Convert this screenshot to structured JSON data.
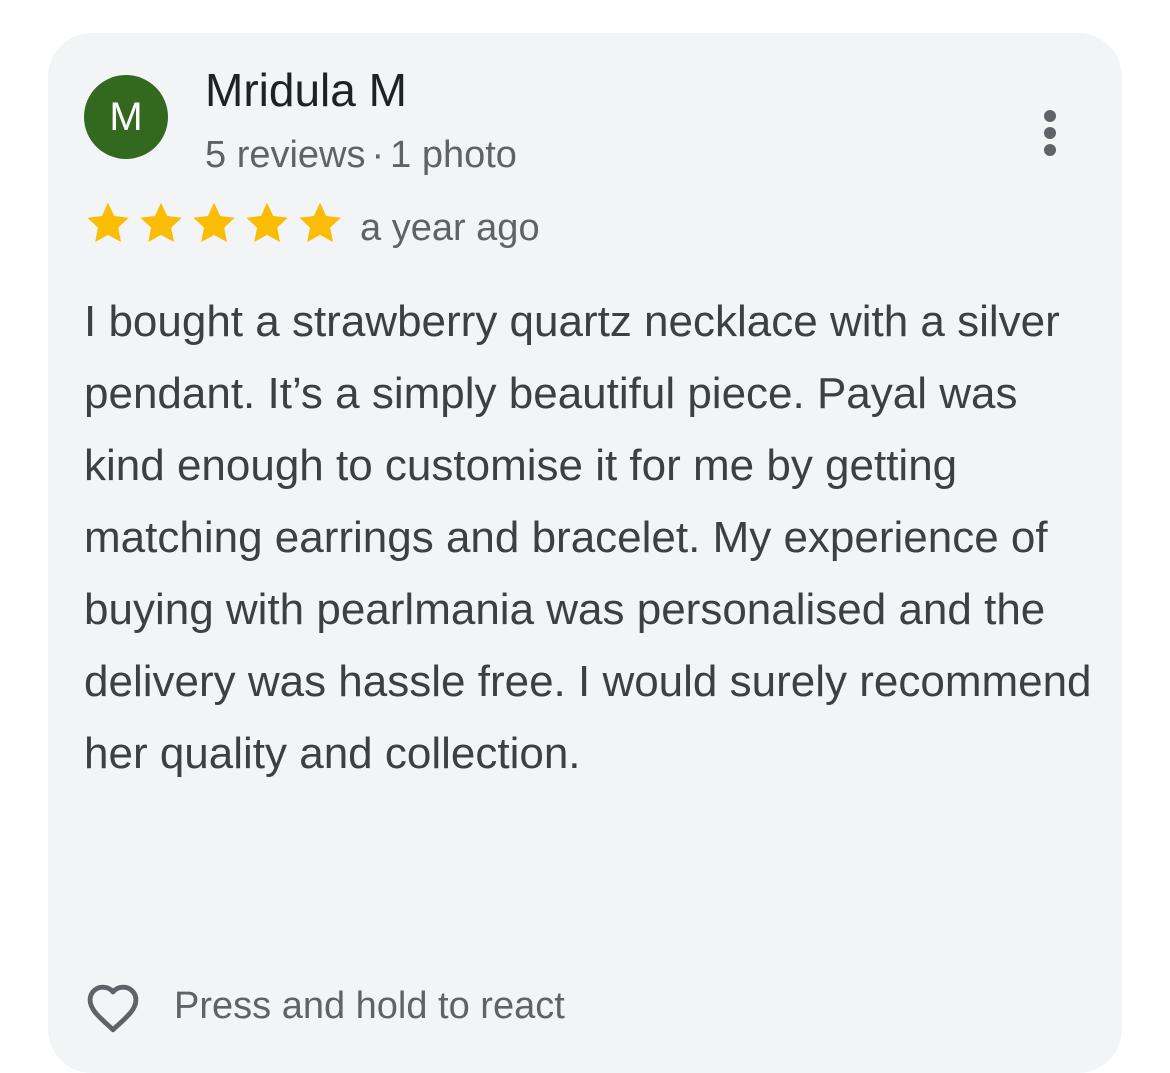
{
  "review": {
    "author_initial": "M",
    "author_name": "Mridula M",
    "reviews_count": "5 reviews",
    "separator": "·",
    "photos_count": "1 photo",
    "rating": 5,
    "max_rating": 5,
    "time_ago": "a year ago",
    "text": "I bought a strawberry quartz necklace with a silver pendant. It’s a simply beautiful piece. Payal was kind enough to customise it for me by getting matching earrings and bracelet. My experience of buying with pearlmania was personalised and the delivery was hassle free. I would surely recommend her quality and collection.",
    "react_label": "Press and hold to react"
  },
  "icons": {
    "menu": "more-vert-icon",
    "star": "star-icon",
    "react": "heart-outline-icon"
  },
  "colors": {
    "avatar_bg": "#33691e",
    "star": "#fbbc04",
    "card_bg": "#f3f4f6"
  }
}
